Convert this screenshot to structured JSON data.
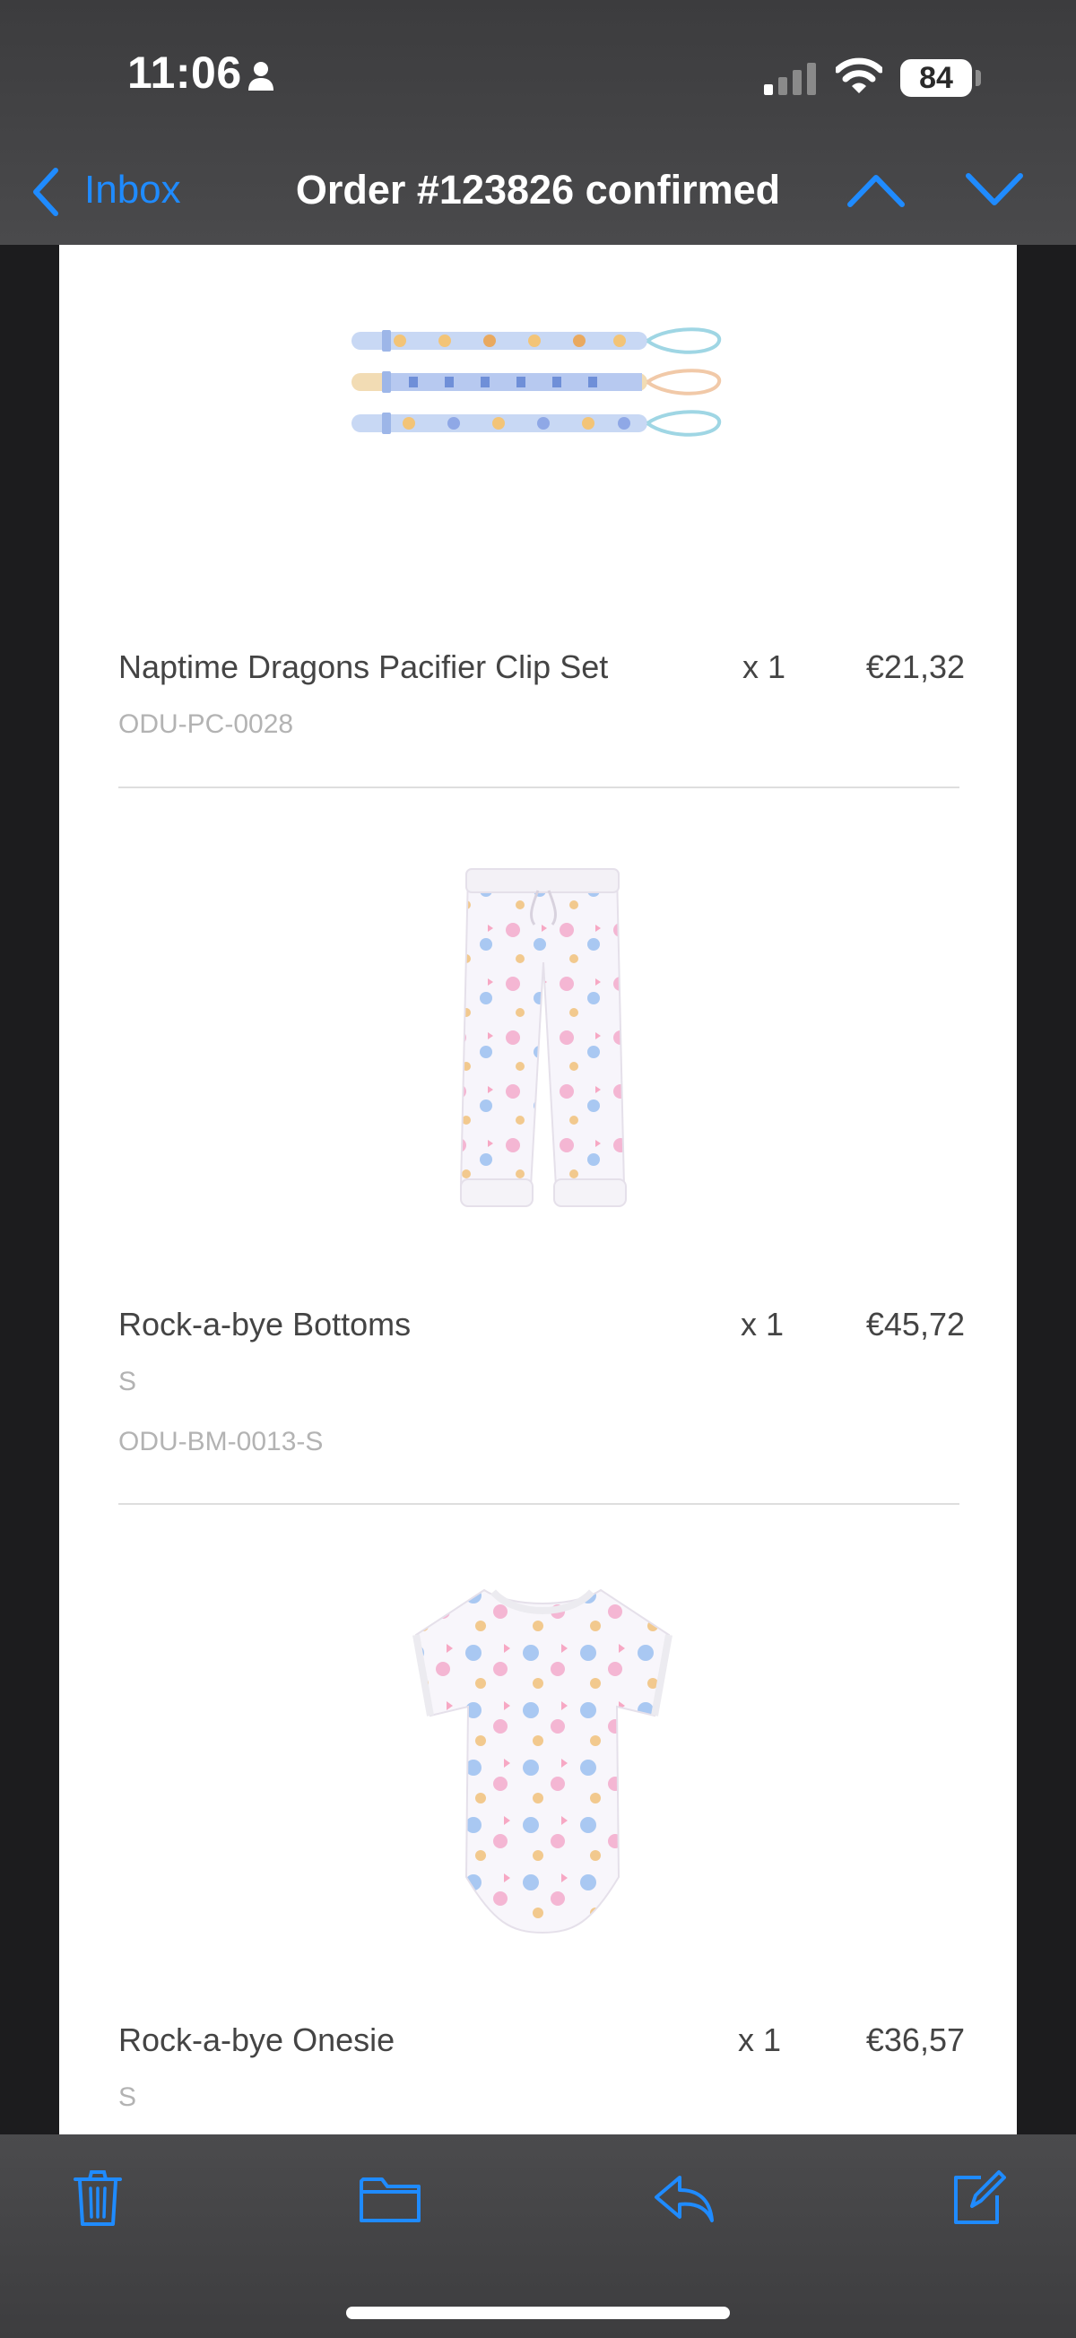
{
  "status_bar": {
    "time": "11:06",
    "battery": "84",
    "icons": [
      "person-icon",
      "cellular-signal-icon",
      "wifi-icon",
      "battery-icon"
    ]
  },
  "nav": {
    "back_label": "Inbox",
    "title": "Order #123826 confirmed",
    "icons": [
      "back-chevron-icon",
      "previous-message-icon",
      "next-message-icon"
    ]
  },
  "items": [
    {
      "name": "Naptime Dragons Pacifier Clip Set",
      "qty": "x 1",
      "price": "€21,32",
      "sku": "ODU-PC-0028"
    },
    {
      "name": "Rock-a-bye Bottoms",
      "qty": "x 1",
      "price": "€45,72",
      "size": "S",
      "sku": "ODU-BM-0013-S"
    },
    {
      "name": "Rock-a-bye Onesie",
      "qty": "x 1",
      "price": "€36,57",
      "size": "S"
    }
  ],
  "toolbar": {
    "icons": [
      "trash-icon",
      "folder-icon",
      "reply-icon",
      "compose-icon"
    ]
  },
  "colors": {
    "accent": "#1f8bff",
    "chrome": "#434345",
    "background": "#1c1c1e",
    "card": "#ffffff",
    "text": "#444444",
    "muted": "#b3b3b3"
  }
}
